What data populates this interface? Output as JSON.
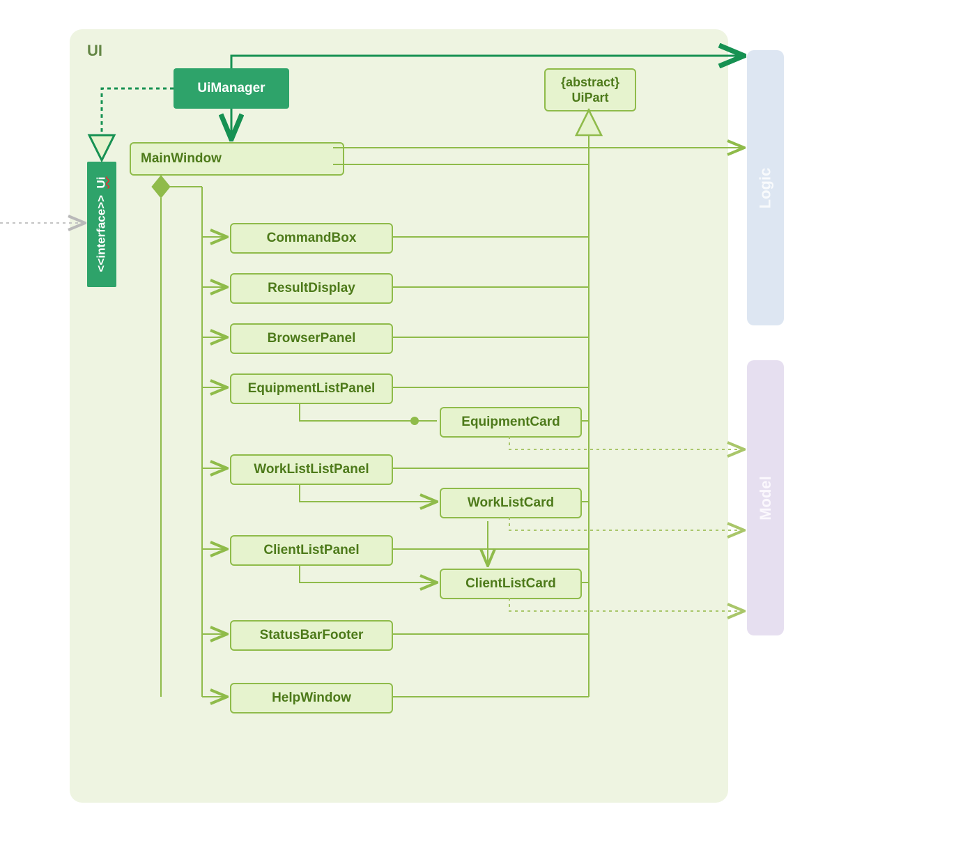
{
  "package": {
    "name": "UI"
  },
  "externals": {
    "logic": "Logic",
    "model": "Model"
  },
  "classes": {
    "ui_interface_stereo": "<<interface>>",
    "ui_interface_name": "Ui",
    "ui_manager": "UiManager",
    "ui_part_stereo": "{abstract}",
    "ui_part_name": "UiPart",
    "main_window": "MainWindow",
    "command_box": "CommandBox",
    "result_display": "ResultDisplay",
    "browser_panel": "BrowserPanel",
    "equipment_list_panel": "EquipmentListPanel",
    "equipment_card": "EquipmentCard",
    "worklist_list_panel": "WorkListListPanel",
    "worklist_card": "WorkListCard",
    "client_list_panel": "ClientListPanel",
    "client_list_card": "ClientListCard",
    "status_bar_footer": "StatusBarFooter",
    "help_window": "HelpWindow"
  }
}
